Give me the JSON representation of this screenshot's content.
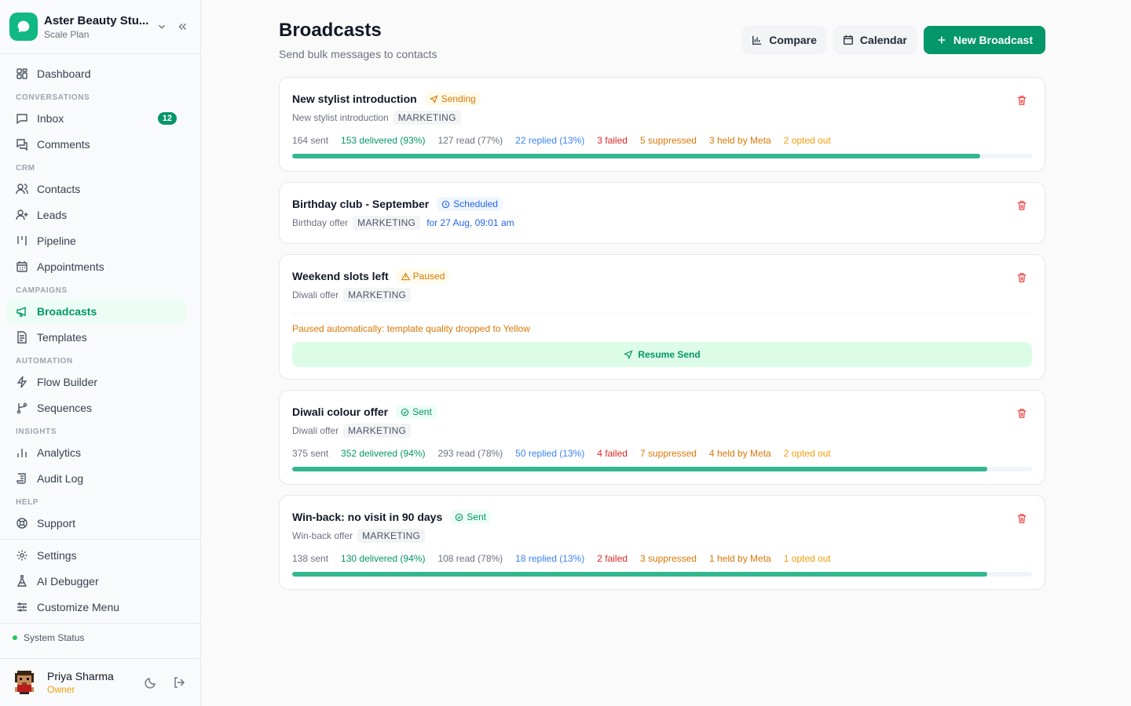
{
  "workspace": {
    "name": "Aster Beauty Stu...",
    "plan": "Scale Plan"
  },
  "sidebar": {
    "dashboard": "Dashboard",
    "sections": {
      "conversations": "CONVERSATIONS",
      "crm": "CRM",
      "campaigns": "CAMPAIGNS",
      "automation": "AUTOMATION",
      "insights": "INSIGHTS",
      "help": "HELP"
    },
    "items": {
      "inbox": "Inbox",
      "inbox_badge": "12",
      "comments": "Comments",
      "contacts": "Contacts",
      "leads": "Leads",
      "pipeline": "Pipeline",
      "appointments": "Appointments",
      "broadcasts": "Broadcasts",
      "templates": "Templates",
      "flow_builder": "Flow Builder",
      "sequences": "Sequences",
      "analytics": "Analytics",
      "audit_log": "Audit Log",
      "support": "Support",
      "settings": "Settings",
      "ai_debugger": "AI Debugger",
      "customize_menu": "Customize Menu"
    },
    "system_status": "System Status"
  },
  "user": {
    "name": "Priya Sharma",
    "role": "Owner"
  },
  "page": {
    "title": "Broadcasts",
    "subtitle": "Send bulk messages to contacts"
  },
  "actions": {
    "compare": "Compare",
    "calendar": "Calendar",
    "new_broadcast": "New Broadcast"
  },
  "broadcasts": [
    {
      "title": "New stylist introduction",
      "status": "Sending",
      "template": "New stylist introduction",
      "category": "MARKETING",
      "stats": {
        "sent": "164 sent",
        "delivered": "153 delivered (93%)",
        "read": "127 read (77%)",
        "replied": "22 replied (13%)",
        "failed": "3 failed",
        "suppressed": "5 suppressed",
        "held": "3 held by Meta",
        "opted": "2 opted out"
      },
      "progress": 0.93
    },
    {
      "title": "Birthday club - September",
      "status": "Scheduled",
      "template": "Birthday offer",
      "category": "MARKETING",
      "schedule": "for 27 Aug, 09:01 am"
    },
    {
      "title": "Weekend slots left",
      "status": "Paused",
      "template": "Diwali offer",
      "category": "MARKETING",
      "paused_message": "Paused automatically: template quality dropped to Yellow",
      "resume_label": "Resume Send"
    },
    {
      "title": "Diwali colour offer",
      "status": "Sent",
      "template": "Diwali offer",
      "category": "MARKETING",
      "stats": {
        "sent": "375 sent",
        "delivered": "352 delivered (94%)",
        "read": "293 read (78%)",
        "replied": "50 replied (13%)",
        "failed": "4 failed",
        "suppressed": "7 suppressed",
        "held": "4 held by Meta",
        "opted": "2 opted out"
      },
      "progress": 0.94
    },
    {
      "title": "Win-back: no visit in 90 days",
      "status": "Sent",
      "template": "Win-back offer",
      "category": "MARKETING",
      "stats": {
        "sent": "138 sent",
        "delivered": "130 delivered (94%)",
        "read": "108 read (78%)",
        "replied": "18 replied (13%)",
        "failed": "2 failed",
        "suppressed": "3 suppressed",
        "held": "1 held by Meta",
        "opted": "1 opted out"
      },
      "progress": 0.94
    }
  ],
  "colors": {
    "accent": "#059669",
    "warning": "#d97706",
    "info": "#2563eb",
    "danger": "#dc2626"
  }
}
